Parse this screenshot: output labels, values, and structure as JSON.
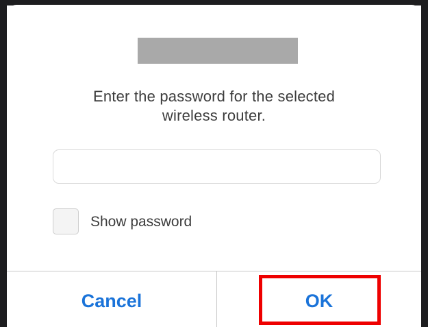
{
  "dialog": {
    "title_redacted": true,
    "message_lines": [
      "Enter the password for the selected",
      "wireless router."
    ],
    "password_value": "",
    "show_password_label": "Show password",
    "show_password_checked": false,
    "cancel_label": "Cancel",
    "ok_label": "OK"
  },
  "colors": {
    "button_text": "#1a73d9",
    "highlight": "#ee0000",
    "redaction": "#a9a9a9"
  }
}
